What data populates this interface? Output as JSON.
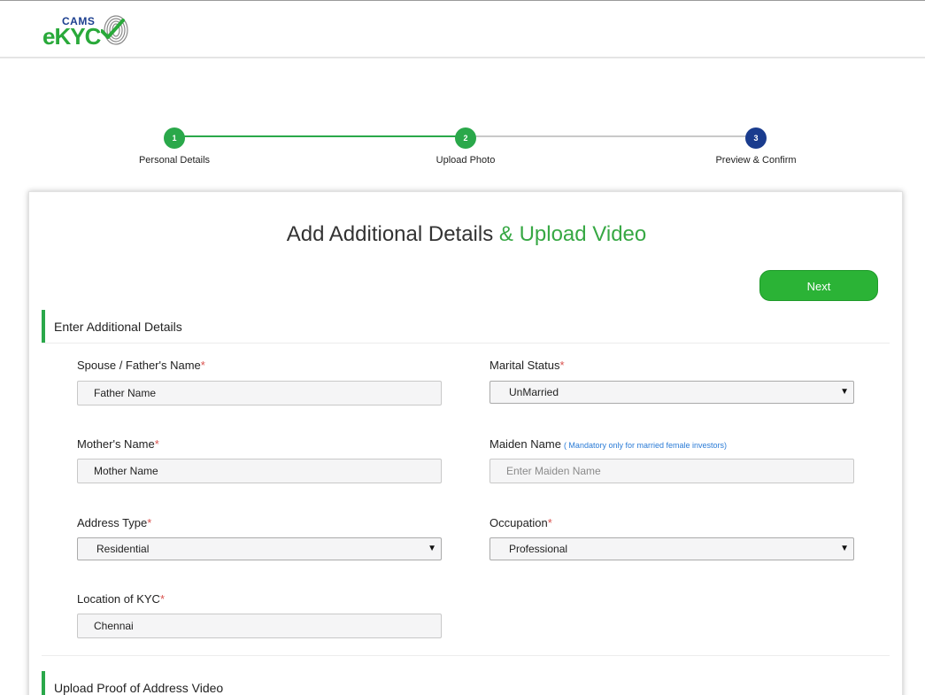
{
  "header": {
    "logo_top": "CAMS",
    "logo_main": "eKYC"
  },
  "stepper": {
    "steps": [
      {
        "number": "1",
        "label": "Personal Details"
      },
      {
        "number": "2",
        "label": "Upload Photo"
      },
      {
        "number": "3",
        "label": "Preview & Confirm"
      }
    ],
    "colors": {
      "done": "#2aa84a",
      "current": "#1a3c8e",
      "pending_line": "#c9c9c9"
    }
  },
  "card": {
    "title_main": "Add Additional Details",
    "title_accent": "& Upload Video",
    "next_label": "Next",
    "section1_title": "Enter Additional Details",
    "section2_title": "Upload Proof of Address Video"
  },
  "form": {
    "spouse": {
      "label": "Spouse / Father's Name",
      "value": "Father Name"
    },
    "marital": {
      "label": "Marital Status",
      "value": "UnMarried"
    },
    "mother": {
      "label": "Mother's Name",
      "value": "Mother Name"
    },
    "maiden": {
      "label": "Maiden Name",
      "hint": "( Mandatory only for married female investors)",
      "placeholder": "Enter Maiden Name"
    },
    "address_type": {
      "label": "Address Type",
      "value": "Residential"
    },
    "occupation": {
      "label": "Occupation",
      "value": "Professional"
    },
    "location": {
      "label": "Location of KYC",
      "value": "Chennai"
    },
    "required_mark": "*"
  },
  "colors": {
    "accent_green": "#2bb336",
    "brand_blue": "#1a3c8e",
    "required_red": "#d9534f",
    "hint_blue": "#2a7bd6"
  }
}
